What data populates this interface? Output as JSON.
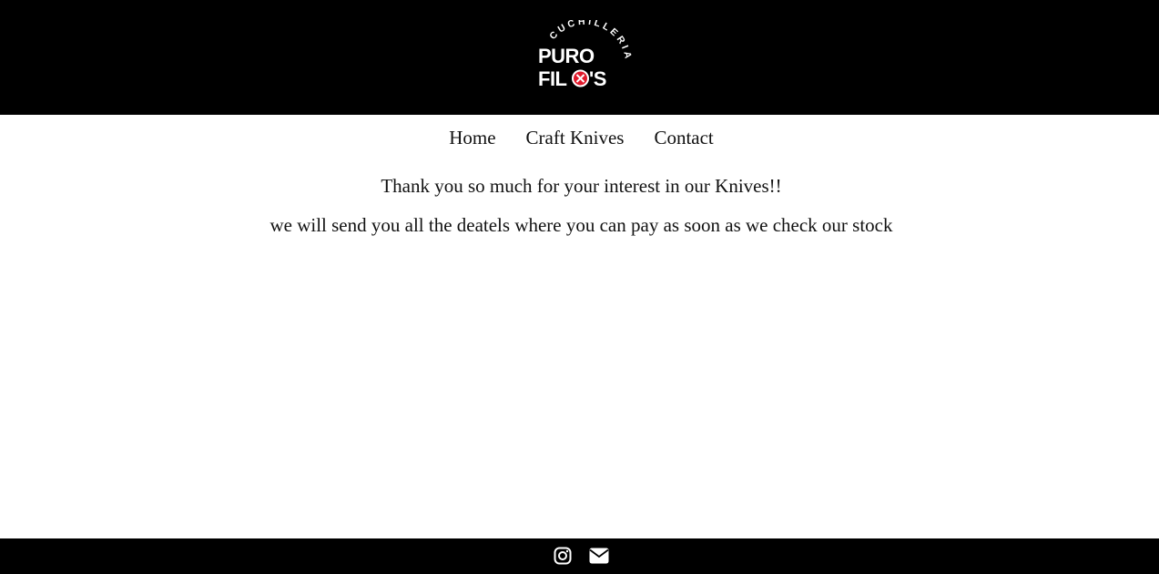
{
  "header": {
    "logo": {
      "arc_text": "CUCHILLERIA",
      "line1": "PURO",
      "line2": "FILO'S",
      "accent_color": "#e0192b"
    }
  },
  "nav": {
    "items": [
      {
        "label": "Home"
      },
      {
        "label": "Craft Knives"
      },
      {
        "label": "Contact"
      }
    ]
  },
  "main": {
    "thank_you": "Thank you so much for your interest in our Knives!!",
    "follow_up": "we will send you all the deatels where you can pay as soon as we check our stock"
  },
  "footer": {
    "icons": [
      "instagram-icon",
      "envelope-icon"
    ]
  },
  "colors": {
    "header_bg": "#000000",
    "footer_bg": "#000000",
    "text": "#111111",
    "logo_text": "#ffffff"
  }
}
